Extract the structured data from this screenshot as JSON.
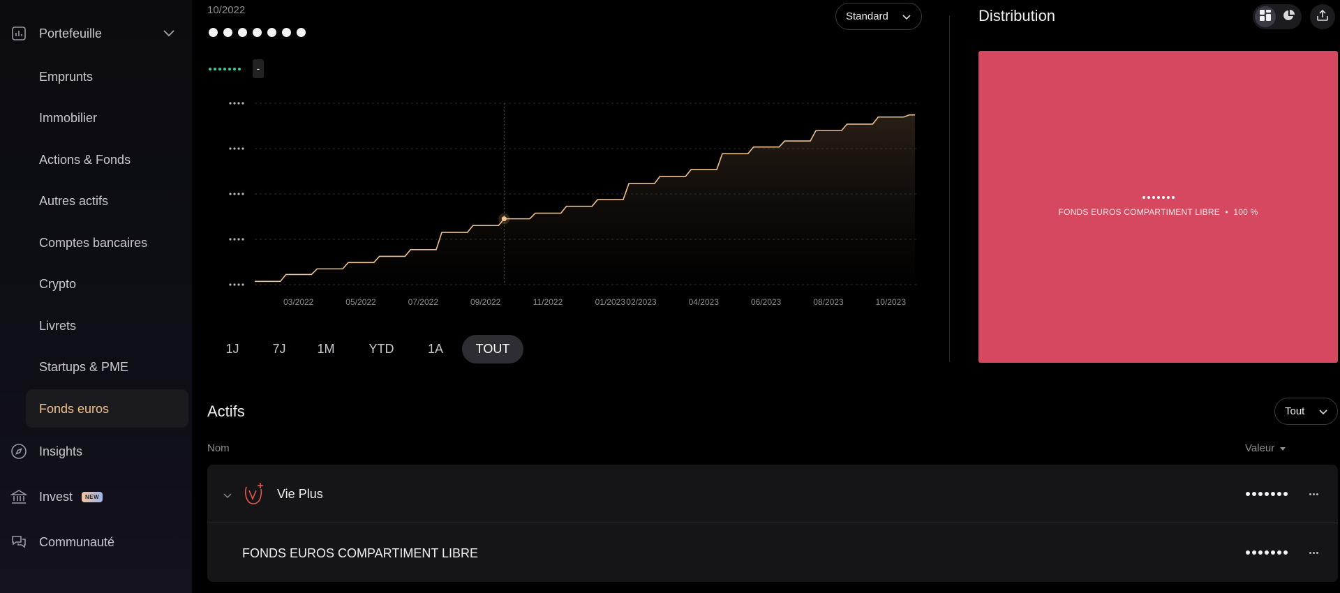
{
  "sidebar": {
    "portefeuille": "Portefeuille",
    "items": [
      "Emprunts",
      "Immobilier",
      "Actions & Fonds",
      "Autres actifs",
      "Comptes bancaires",
      "Crypto",
      "Livrets",
      "Startups & PME",
      "Fonds euros"
    ],
    "active": "Fonds euros",
    "insights": "Insights",
    "invest": "Invest",
    "invest_badge": "NEW",
    "communaute": "Communauté"
  },
  "header": {
    "date": "10/2022",
    "standard_select": "Standard",
    "variation": "-"
  },
  "chart_data": {
    "type": "area",
    "title": "",
    "xlabel": "",
    "ylabel": "",
    "x_ticks": [
      "03/2022",
      "05/2022",
      "07/2022",
      "09/2022",
      "11/2022",
      "01/2023",
      "02/2023",
      "04/2023",
      "06/2023",
      "08/2023",
      "10/2023"
    ],
    "y_ticks_masked": true,
    "series": [
      {
        "style": "step",
        "x": [
          "02/2022",
          "03/2022",
          "04/2022",
          "05/2022",
          "06/2022",
          "07/2022",
          "08/2022",
          "09/2022",
          "10/2022",
          "11/2022",
          "12/2022",
          "01/2023",
          "02/2023",
          "03/2023",
          "04/2023",
          "05/2023",
          "06/2023",
          "07/2023",
          "08/2023",
          "09/2023",
          "10/2023",
          "11/2023"
        ],
        "values": [
          0.18,
          0.56,
          0.87,
          1.22,
          1.56,
          1.93,
          2.88,
          3.26,
          3.63,
          3.94,
          4.32,
          4.69,
          5.57,
          5.97,
          6.35,
          7.22,
          7.59,
          7.92,
          8.49,
          8.85,
          9.24,
          9.36
        ]
      }
    ],
    "hover": {
      "x": "10/2022",
      "value": 3.63
    },
    "grid": true,
    "area_fill": true
  },
  "range_buttons": [
    "1J",
    "7J",
    "1M",
    "YTD",
    "1A",
    "TOUT"
  ],
  "range_selected": "TOUT",
  "distribution": {
    "title": "Distribution",
    "label": "FONDS EUROS COMPARTIMENT LIBRE",
    "percent": "100 %",
    "color": "#d5485f"
  },
  "actifs": {
    "title": "Actifs",
    "filter": "Tout",
    "col_nom": "Nom",
    "col_valeur": "Valeur",
    "rows": [
      {
        "name": "Vie Plus"
      },
      {
        "name": "FONDS EUROS COMPARTIMENT LIBRE"
      }
    ]
  },
  "colors": {
    "accent": "#f1c28f",
    "positive": "#2fd29b",
    "line": "#f0c290"
  }
}
